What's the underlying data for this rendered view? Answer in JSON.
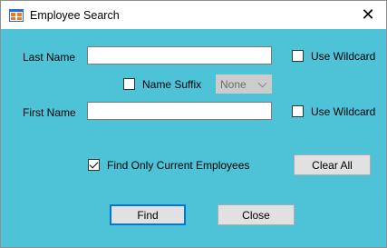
{
  "window": {
    "title": "Employee Search",
    "close_glyph": "✕"
  },
  "form": {
    "last_name": {
      "label": "Last Name",
      "value": "",
      "wildcard_label": "Use Wildcard",
      "wildcard_checked": false
    },
    "name_suffix": {
      "label": "Name Suffix",
      "checked": false,
      "selected": "None",
      "enabled": false
    },
    "first_name": {
      "label": "First Name",
      "value": "",
      "wildcard_label": "Use Wildcard",
      "wildcard_checked": false
    },
    "current_employees": {
      "label": "Find Only Current Employees",
      "checked": true
    }
  },
  "buttons": {
    "clear_all": "Clear All",
    "find": "Find",
    "close": "Close"
  },
  "colors": {
    "form_background": "#4ec3d7",
    "default_button_border": "#0078d7",
    "icon_orange": "#f0781e",
    "icon_blue": "#2a6ad6"
  },
  "icons": {
    "app": "form-window-icon",
    "close": "close-icon",
    "dropdown": "chevron-down-icon",
    "check": "checkmark"
  }
}
